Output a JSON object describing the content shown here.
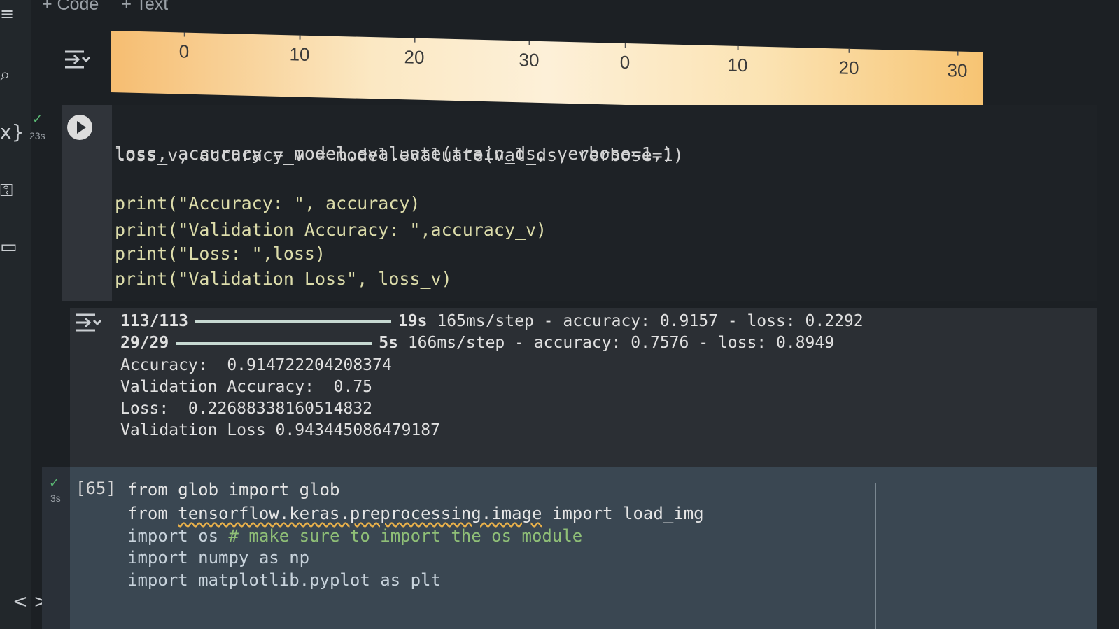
{
  "toolbar": {
    "add_code": "+ Code",
    "add_text": "+ Text"
  },
  "colorbar": {
    "ticks_left": [
      "0",
      "10",
      "20",
      "30"
    ],
    "ticks_right": [
      "0",
      "10",
      "20",
      "30"
    ]
  },
  "cell1": {
    "exec_time": "23s",
    "lines": [
      "loss, accuracy = model.evaluate(train_ds, verbose=1,)",
      "loss_v, accuracy_v = model.evaluate(val_ds, verbose=1)",
      "",
      "print(\"Accuracy: \", accuracy)",
      "print(\"Validation Accuracy: \",accuracy_v)",
      "print(\"Loss: \",loss)",
      "print(\"Validation Loss\", loss_v)"
    ]
  },
  "output": {
    "progress": [
      {
        "count": "113/113",
        "time": "19s",
        "rest": "165ms/step - accuracy: 0.9157 - loss: 0.2292",
        "fill": 1.0
      },
      {
        "count": "29/29",
        "time": "5s",
        "rest": "166ms/step - accuracy: 0.7576 - loss: 0.8949",
        "fill": 1.0
      }
    ],
    "lines": [
      "Accuracy:  0.914722204208374",
      "Validation Accuracy:  0.75",
      "Loss:  0.22688338160514832",
      "Validation Loss 0.943445086479187"
    ]
  },
  "cell2": {
    "exec_count": "[65]",
    "exec_time": "3s",
    "line1": "from glob import glob",
    "line2_a": "from ",
    "line2_module": "tensorflow.keras.preprocessing.image",
    "line2_b": " import load_img",
    "line3_a": "import os ",
    "line3_comment": "# make sure to import the os module",
    "line4": "import numpy as np",
    "line5": "import matplotlib.pyplot as plt"
  },
  "nav": {
    "arrows": "< >"
  }
}
